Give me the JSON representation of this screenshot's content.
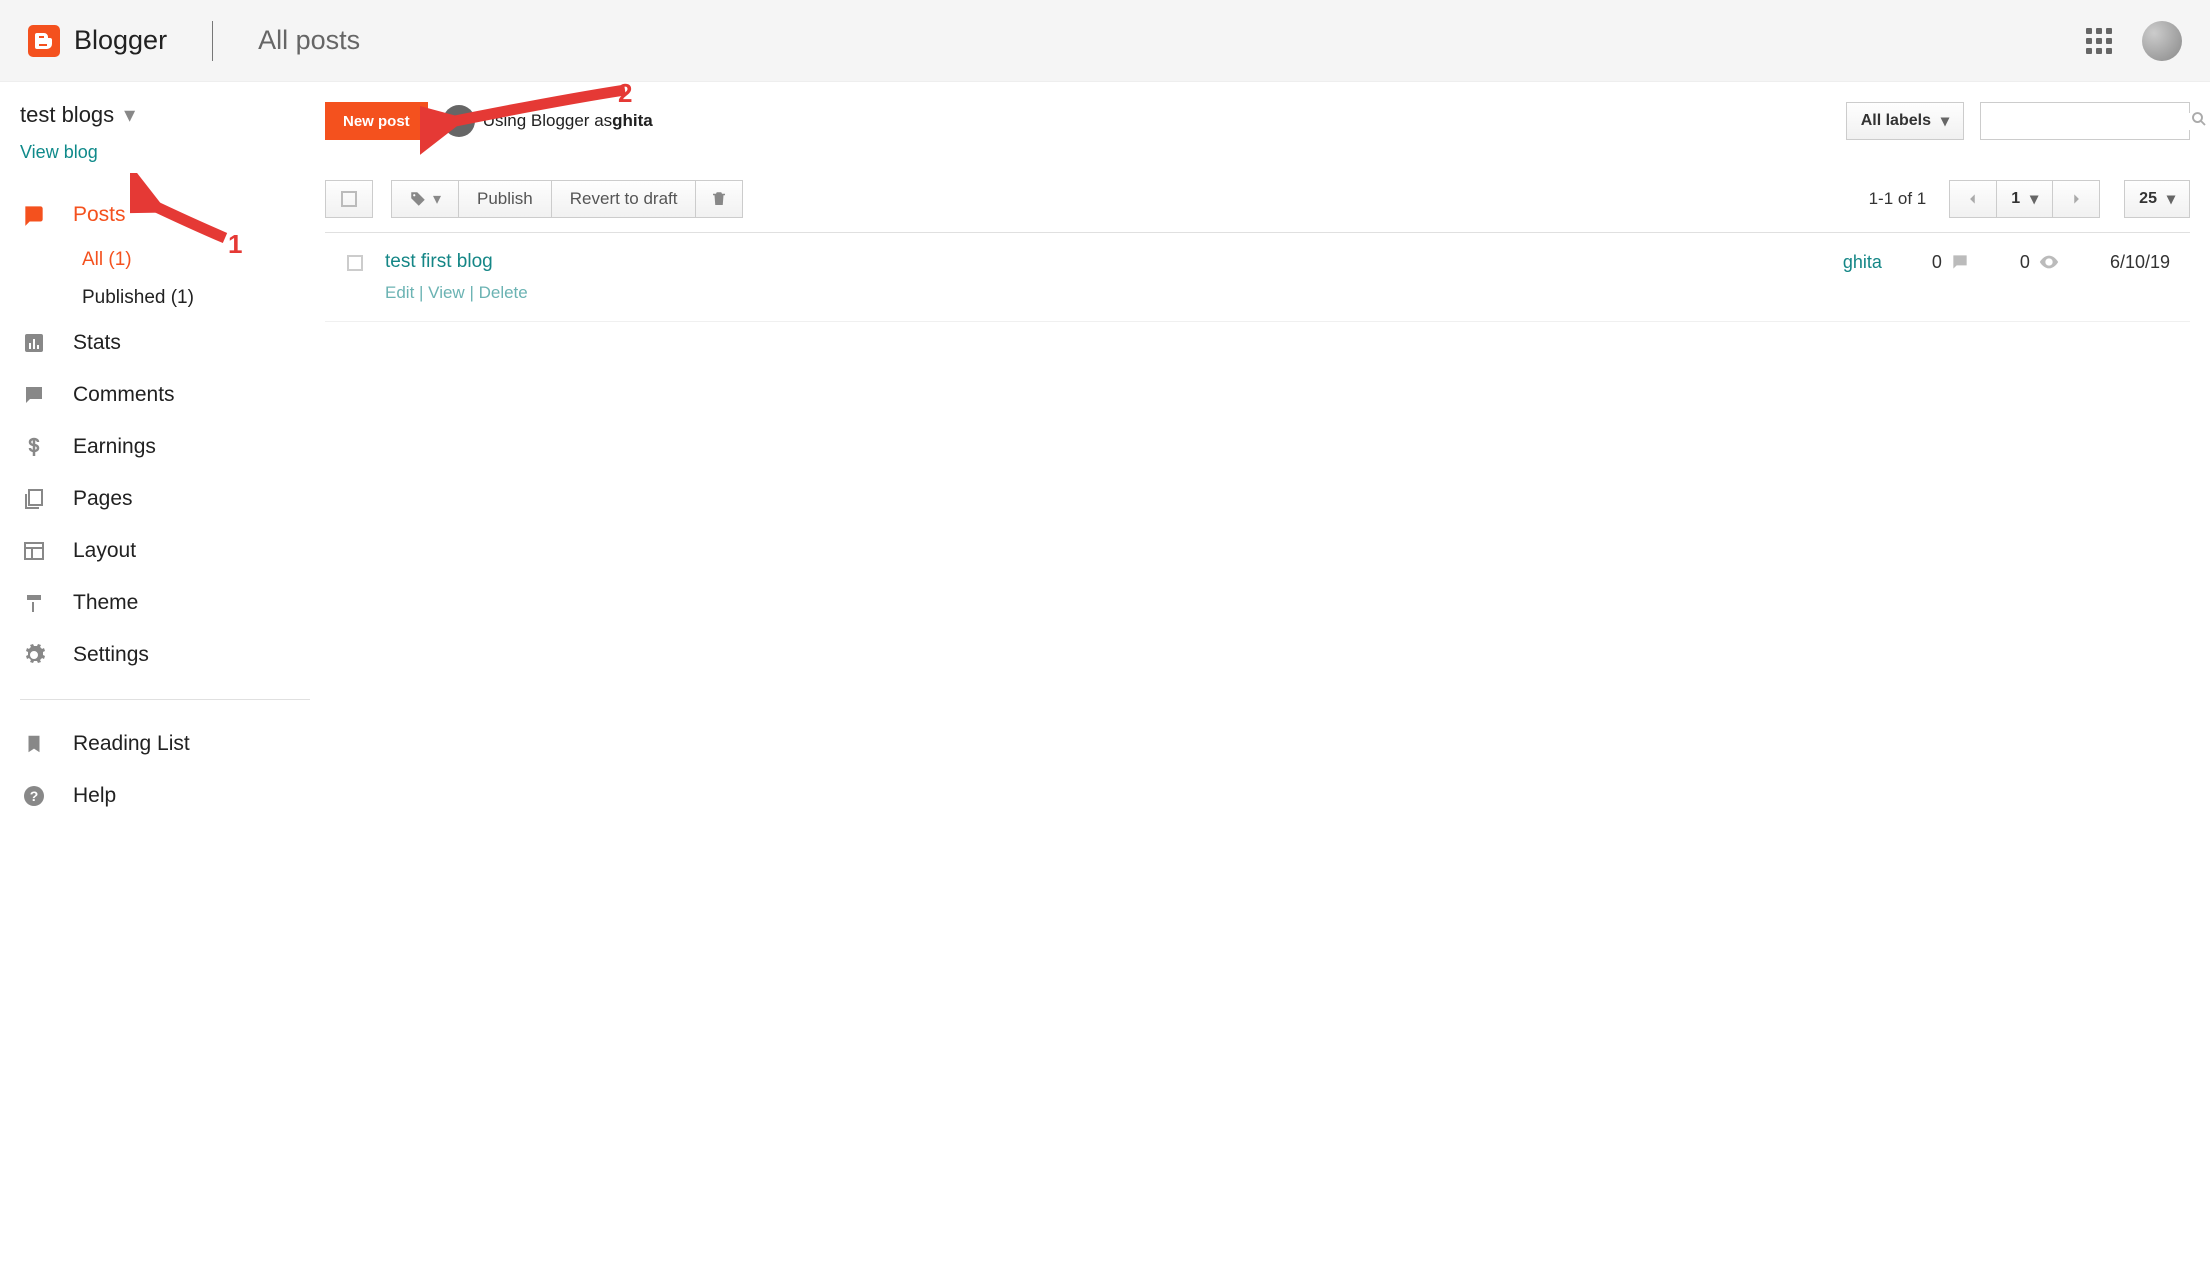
{
  "header": {
    "logoText": "Blogger",
    "pageTitle": "All posts"
  },
  "sidebar": {
    "blogName": "test blogs",
    "viewBlog": "View blog",
    "nav": {
      "posts": "Posts",
      "all": "All (1)",
      "published": "Published (1)",
      "stats": "Stats",
      "comments": "Comments",
      "earnings": "Earnings",
      "pages": "Pages",
      "layout": "Layout",
      "theme": "Theme",
      "settings": "Settings",
      "readingList": "Reading List",
      "help": "Help"
    }
  },
  "main": {
    "newPost": "New post",
    "usingBloggerPrefix": "Using Blogger as ",
    "userName": "ghita",
    "allLabels": "All labels",
    "publish": "Publish",
    "revertToDraft": "Revert to draft",
    "rangeText": "1-1 of 1",
    "pageNum": "1",
    "perPage": "25"
  },
  "post": {
    "title": "test first blog",
    "edit": "Edit",
    "view": "View",
    "delete": "Delete",
    "author": "ghita",
    "comments": "0",
    "views": "0",
    "date": "6/10/19"
  },
  "annotations": {
    "n1": "1",
    "n2": "2"
  }
}
